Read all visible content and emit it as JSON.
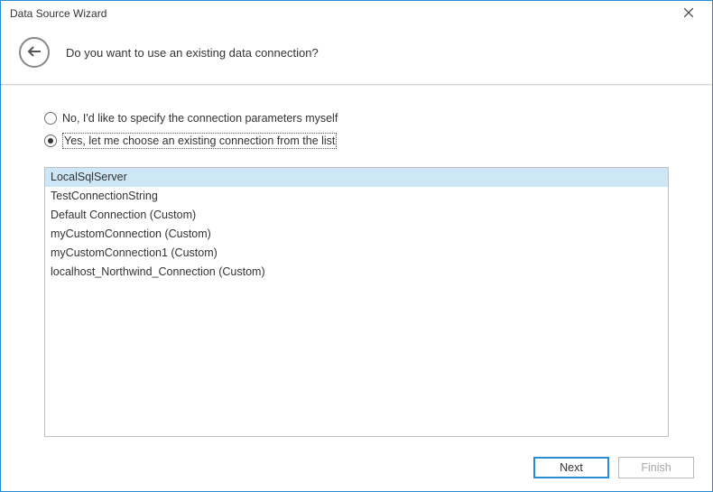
{
  "window": {
    "title": "Data Source Wizard"
  },
  "header": {
    "question": "Do you want to use an existing data connection?"
  },
  "options": {
    "no": {
      "label": "No, I'd like to specify the connection parameters myself",
      "checked": false
    },
    "yes": {
      "label": "Yes, let me choose an existing connection from the list",
      "checked": true
    }
  },
  "connections": {
    "items": [
      {
        "label": "LocalSqlServer",
        "selected": true
      },
      {
        "label": "TestConnectionString",
        "selected": false
      },
      {
        "label": "Default Connection (Custom)",
        "selected": false
      },
      {
        "label": "myCustomConnection (Custom)",
        "selected": false
      },
      {
        "label": "myCustomConnection1 (Custom)",
        "selected": false
      },
      {
        "label": "localhost_Northwind_Connection (Custom)",
        "selected": false
      }
    ]
  },
  "footer": {
    "next": "Next",
    "finish": "Finish"
  }
}
